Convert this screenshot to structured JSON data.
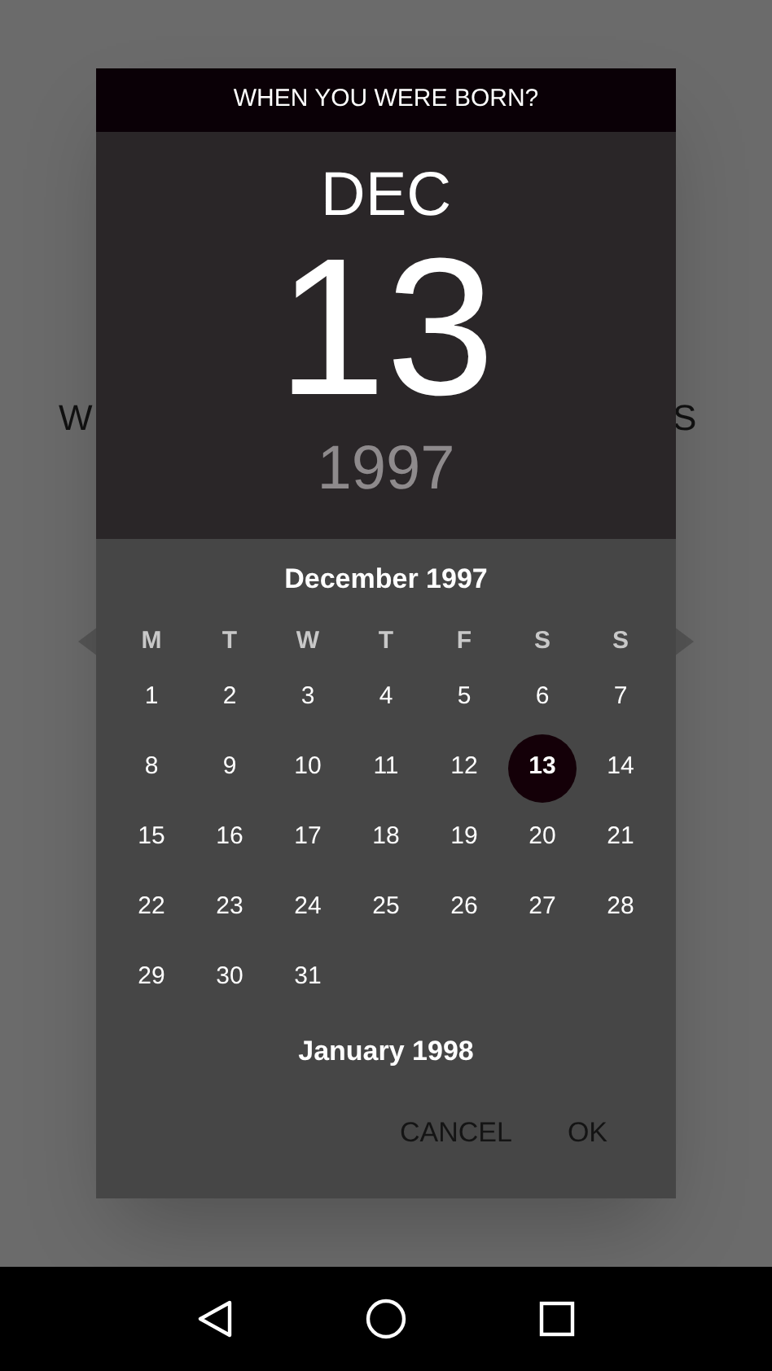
{
  "background": {
    "left_text": "W",
    "right_text": "S"
  },
  "dialog": {
    "title": "WHEN YOU WERE BORN?",
    "month": "DEC",
    "day": "13",
    "year": "1997",
    "calendar": {
      "month_title": "December 1997",
      "weekdays": [
        "M",
        "T",
        "W",
        "T",
        "F",
        "S",
        "S"
      ],
      "days": [
        {
          "label": "1",
          "selected": false
        },
        {
          "label": "2",
          "selected": false
        },
        {
          "label": "3",
          "selected": false
        },
        {
          "label": "4",
          "selected": false
        },
        {
          "label": "5",
          "selected": false
        },
        {
          "label": "6",
          "selected": false
        },
        {
          "label": "7",
          "selected": false
        },
        {
          "label": "8",
          "selected": false
        },
        {
          "label": "9",
          "selected": false
        },
        {
          "label": "10",
          "selected": false
        },
        {
          "label": "11",
          "selected": false
        },
        {
          "label": "12",
          "selected": false
        },
        {
          "label": "13",
          "selected": true
        },
        {
          "label": "14",
          "selected": false
        },
        {
          "label": "15",
          "selected": false
        },
        {
          "label": "16",
          "selected": false
        },
        {
          "label": "17",
          "selected": false
        },
        {
          "label": "18",
          "selected": false
        },
        {
          "label": "19",
          "selected": false
        },
        {
          "label": "20",
          "selected": false
        },
        {
          "label": "21",
          "selected": false
        },
        {
          "label": "22",
          "selected": false
        },
        {
          "label": "23",
          "selected": false
        },
        {
          "label": "24",
          "selected": false
        },
        {
          "label": "25",
          "selected": false
        },
        {
          "label": "26",
          "selected": false
        },
        {
          "label": "27",
          "selected": false
        },
        {
          "label": "28",
          "selected": false
        },
        {
          "label": "29",
          "selected": false
        },
        {
          "label": "30",
          "selected": false
        },
        {
          "label": "31",
          "selected": false
        }
      ],
      "next_month_title": "January 1998"
    },
    "buttons": [
      "CANCEL",
      "OK"
    ]
  }
}
